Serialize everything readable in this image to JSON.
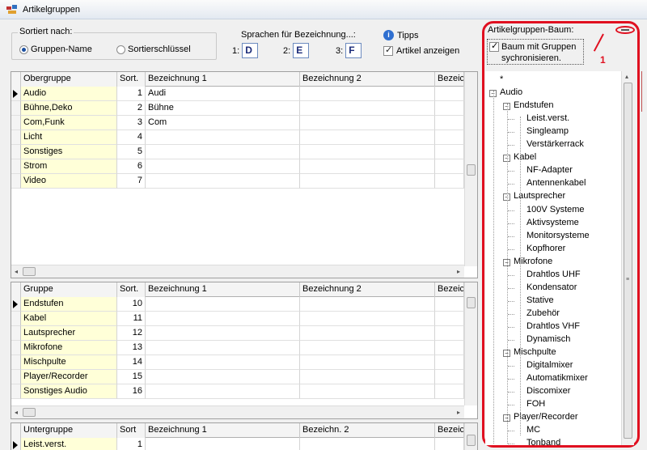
{
  "window": {
    "title": "Artikelgruppen"
  },
  "sort": {
    "caption": "Sortiert nach:",
    "options": [
      {
        "label": "Gruppen-Name",
        "selected": true
      },
      {
        "label": "Sortierschlüssel",
        "selected": false
      }
    ]
  },
  "languages": {
    "caption": "Sprachen für Bezeichnung...:",
    "slots": [
      {
        "num": "1:",
        "value": "D"
      },
      {
        "num": "2:",
        "value": "E"
      },
      {
        "num": "3:",
        "value": "F"
      }
    ]
  },
  "tipps": {
    "label": "Tipps"
  },
  "show_articles": {
    "label": "Artikel anzeigen",
    "checked": true
  },
  "grid1": {
    "headers": [
      "Obergruppe",
      "Sort.",
      "Bezeichnung 1",
      "Bezeichnung 2",
      "Bezeic"
    ],
    "rows": [
      {
        "name": "Audio",
        "sort": "1",
        "b1": "Audi",
        "current": true
      },
      {
        "name": "Bühne,Deko",
        "sort": "2",
        "b1": "Bühne"
      },
      {
        "name": "Com,Funk",
        "sort": "3",
        "b1": "Com"
      },
      {
        "name": "Licht",
        "sort": "4",
        "b1": ""
      },
      {
        "name": "Sonstiges",
        "sort": "5",
        "b1": ""
      },
      {
        "name": "Strom",
        "sort": "6",
        "b1": ""
      },
      {
        "name": "Video",
        "sort": "7",
        "b1": ""
      }
    ]
  },
  "grid2": {
    "headers": [
      "Gruppe",
      "Sort.",
      "Bezeichnung 1",
      "Bezeichnung 2",
      "Bezeic"
    ],
    "rows": [
      {
        "name": "Endstufen",
        "sort": "10",
        "current": true
      },
      {
        "name": "Kabel",
        "sort": "11"
      },
      {
        "name": "Lautsprecher",
        "sort": "12"
      },
      {
        "name": "Mikrofone",
        "sort": "13"
      },
      {
        "name": "Mischpulte",
        "sort": "14"
      },
      {
        "name": "Player/Recorder",
        "sort": "15"
      },
      {
        "name": "Sonstiges Audio",
        "sort": "16"
      }
    ]
  },
  "grid3": {
    "headers": [
      "Untergruppe",
      "Sort",
      "Bezeichnung 1",
      "Bezeichn. 2",
      "Bezeic"
    ],
    "rows": [
      {
        "name": "Leist.verst.",
        "sort": "1",
        "current": true
      }
    ]
  },
  "tree": {
    "caption": "Artikelgruppen-Baum:",
    "sync_label": "Baum mit Gruppen sychronisieren.",
    "callout": "1",
    "nodes": [
      {
        "label": "*",
        "level": 0,
        "expander": false
      },
      {
        "label": "Audio",
        "level": 0,
        "expander": true
      },
      {
        "label": "Endstufen",
        "level": 1,
        "expander": true
      },
      {
        "label": "Leist.verst.",
        "level": 2,
        "expander": false
      },
      {
        "label": "Singleamp",
        "level": 2,
        "expander": false
      },
      {
        "label": "Verstärkerrack",
        "level": 2,
        "expander": false
      },
      {
        "label": "Kabel",
        "level": 1,
        "expander": true
      },
      {
        "label": "NF-Adapter",
        "level": 2,
        "expander": false
      },
      {
        "label": "Antennenkabel",
        "level": 2,
        "expander": false
      },
      {
        "label": "Lautsprecher",
        "level": 1,
        "expander": true
      },
      {
        "label": "100V Systeme",
        "level": 2,
        "expander": false
      },
      {
        "label": "Aktivsysteme",
        "level": 2,
        "expander": false
      },
      {
        "label": "Monitorsysteme",
        "level": 2,
        "expander": false
      },
      {
        "label": "Kopfhorer",
        "level": 2,
        "expander": false
      },
      {
        "label": "Mikrofone",
        "level": 1,
        "expander": true
      },
      {
        "label": "Drahtlos UHF",
        "level": 2,
        "expander": false
      },
      {
        "label": "Kondensator",
        "level": 2,
        "expander": false
      },
      {
        "label": "Stative",
        "level": 2,
        "expander": false
      },
      {
        "label": "Zubehör",
        "level": 2,
        "expander": false
      },
      {
        "label": "Drahtlos VHF",
        "level": 2,
        "expander": false
      },
      {
        "label": "Dynamisch",
        "level": 2,
        "expander": false
      },
      {
        "label": "Mischpulte",
        "level": 1,
        "expander": true
      },
      {
        "label": "Digitalmixer",
        "level": 2,
        "expander": false
      },
      {
        "label": "Automatikmixer",
        "level": 2,
        "expander": false
      },
      {
        "label": "Discomixer",
        "level": 2,
        "expander": false
      },
      {
        "label": "FOH",
        "level": 2,
        "expander": false
      },
      {
        "label": "Player/Recorder",
        "level": 1,
        "expander": true
      },
      {
        "label": "MC",
        "level": 2,
        "expander": false
      },
      {
        "label": "Tonband",
        "level": 2,
        "expander": false
      }
    ]
  },
  "icons": {
    "app": "app-grid-icon",
    "row_pointer": "row-pointer-icon",
    "info": "info-icon",
    "minimize": "minimize-icon"
  },
  "colors": {
    "highlight": "#e01020",
    "name_cell": "#ffffd8"
  }
}
